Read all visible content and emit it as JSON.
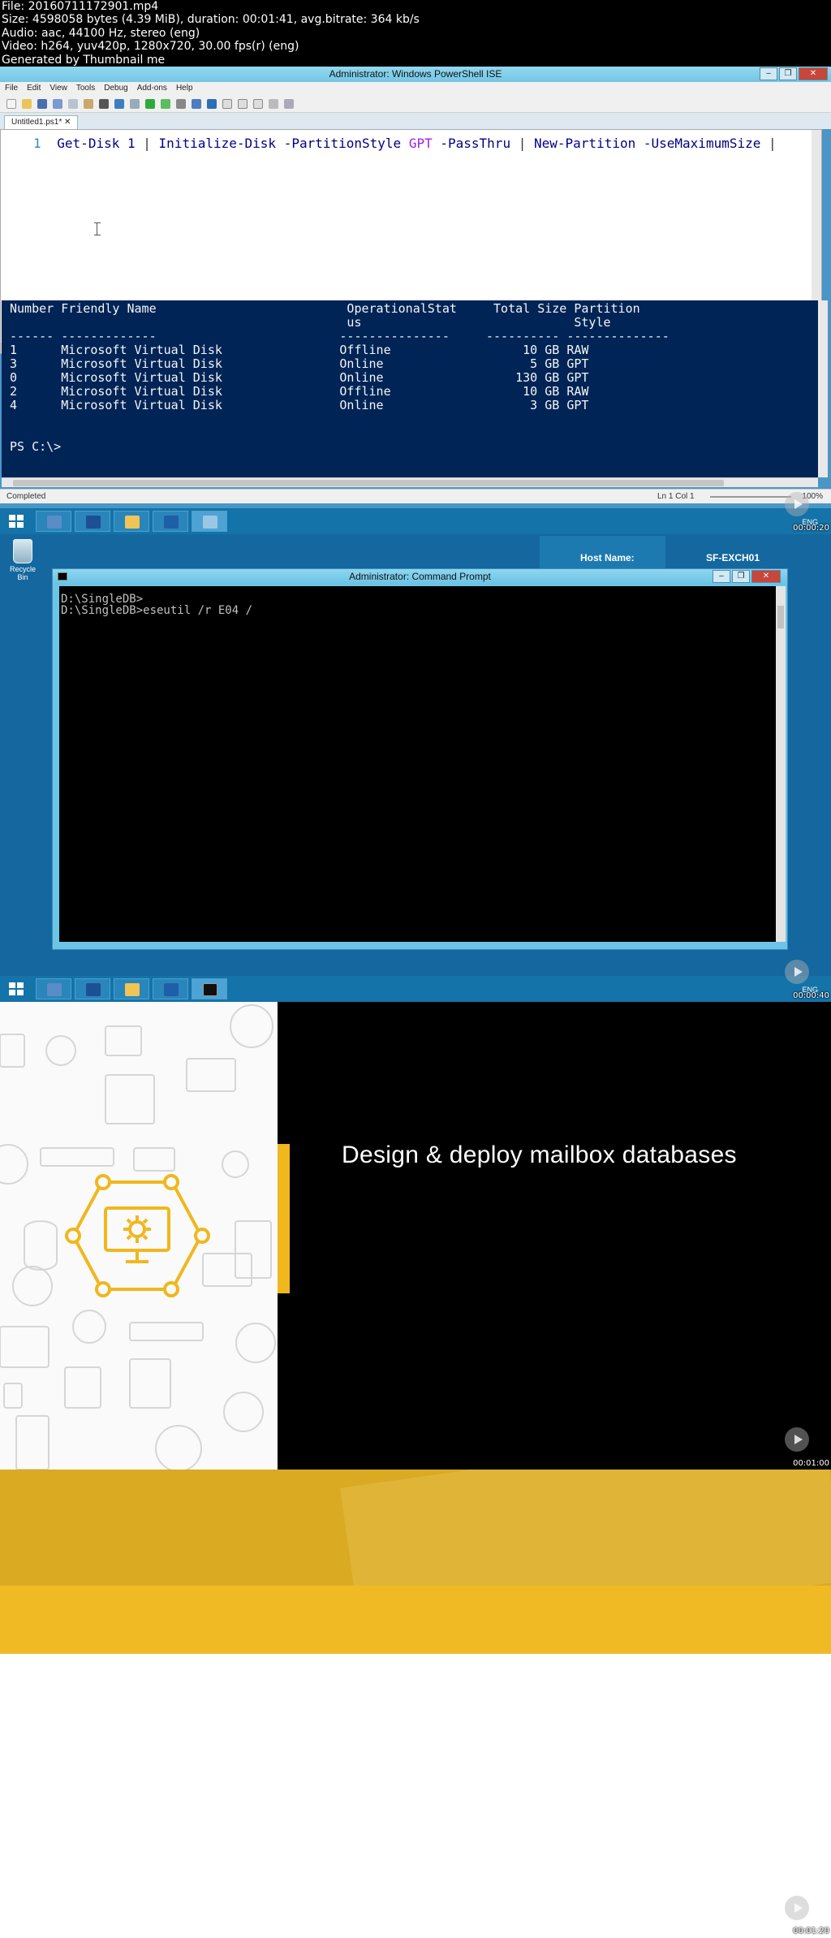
{
  "info": {
    "line1": "File: 20160711172901.mp4",
    "line2": "Size: 4598058 bytes (4.39 MiB), duration: 00:01:41, avg.bitrate: 364 kb/s",
    "line3": "Audio: aac, 44100 Hz, stereo (eng)",
    "line4": "Video: h264, yuv420p, 1280x720, 30.00 fps(r) (eng)",
    "line5": "Generated by Thumbnail me"
  },
  "ise": {
    "title": "Administrator: Windows PowerShell ISE",
    "menu": [
      "File",
      "Edit",
      "View",
      "Tools",
      "Debug",
      "Add-ons",
      "Help"
    ],
    "tab": "Untitled1.ps1* ✕",
    "code": {
      "line_no": "1",
      "cmd1": "Get-Disk",
      "arg1": "1",
      "pipe1": "|",
      "cmd2": "Initialize-Disk",
      "param1": "-PartitionStyle",
      "kw1": "GPT",
      "param2": "-PassThru",
      "pipe2": "|",
      "cmd3": "New-Partition",
      "param3": "-UseMaximumSize",
      "pipe3": "|"
    },
    "console": {
      "header1": "Number Friendly Name                          OperationalStat     Total Size Partition",
      "header2": "                                              us                             Style",
      "divider": "------ -------------                         ---------------     ---------- --------------",
      "rows": [
        "1      Microsoft Virtual Disk                Offline                  10 GB RAW",
        "3      Microsoft Virtual Disk                Online                    5 GB GPT",
        "0      Microsoft Virtual Disk                Online                  130 GB GPT",
        "2      Microsoft Virtual Disk                Offline                  10 GB RAW",
        "4      Microsoft Virtual Disk                Online                    3 GB GPT"
      ],
      "prompt": "PS C:\\>"
    },
    "status": "Completed",
    "cursor_pos": "Ln 1  Col 1",
    "zoom": "100%"
  },
  "frame1": {
    "eng": "ENG",
    "timestamp": "00:00:20"
  },
  "desktop": {
    "recycle_label": "Recycle Bin",
    "host_label": "Host Name:",
    "host_value": "SF-EXCH01"
  },
  "cmd": {
    "title": "Administrator: Command Prompt",
    "line1": "D:\\SingleDB>",
    "line2": "D:\\SingleDB>eseutil /r E04 /"
  },
  "frame2": {
    "eng": "ENG",
    "timestamp": "00:00:40"
  },
  "slide": {
    "title": "Design & deploy mailbox databases",
    "timestamp": "00:01:00"
  },
  "frame4": {
    "timestamp": "00:01:20"
  },
  "colors": {
    "ps_console_bg": "#012456",
    "accent_yellow": "#f0b71e",
    "desktop_blue": "#14679f"
  }
}
